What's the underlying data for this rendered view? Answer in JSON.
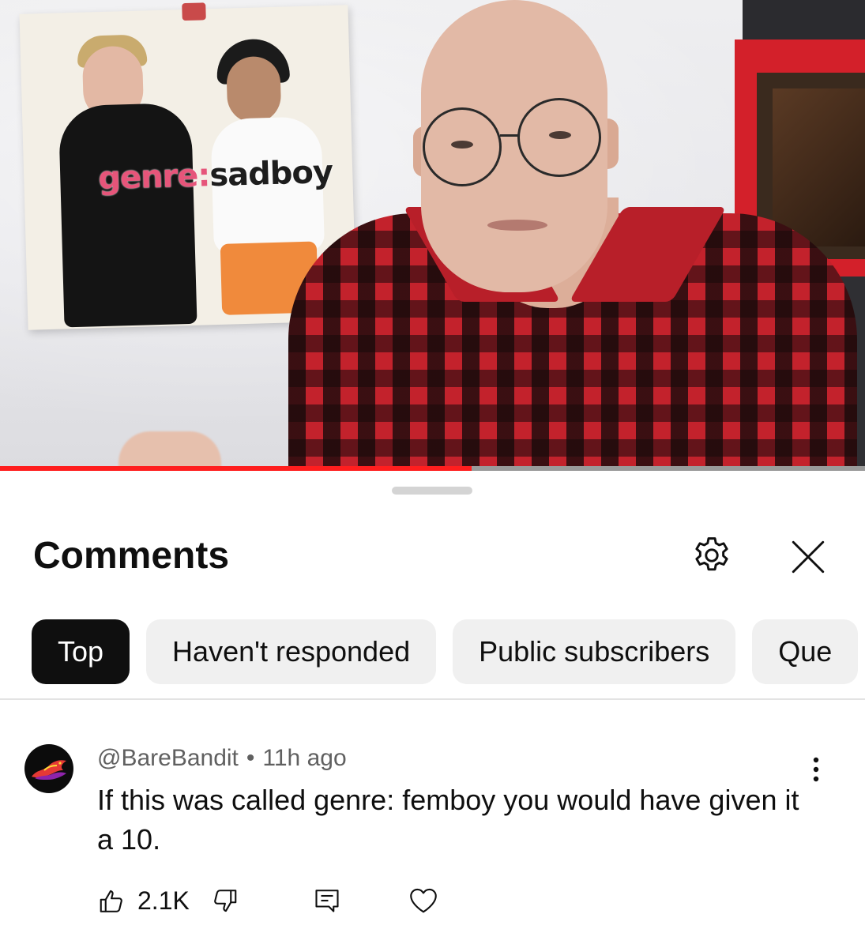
{
  "video": {
    "poster_text_genre": "genre",
    "poster_text_colon": ":",
    "poster_text_sadboy": "sadboy",
    "progress_fraction": 0.545,
    "colors": {
      "progress": "#ff1e1e",
      "shirt_red": "#c3222c",
      "shelf_red": "#d3202a"
    }
  },
  "comments_panel": {
    "title": "Comments",
    "settings_icon": "gear-icon",
    "close_icon": "close-icon",
    "filters": [
      {
        "label": "Top",
        "selected": true
      },
      {
        "label": "Haven't responded",
        "selected": false
      },
      {
        "label": "Public subscribers",
        "selected": false
      },
      {
        "label": "Que",
        "selected": false
      }
    ],
    "comment": {
      "author": "@BareBandit",
      "separator": "•",
      "time": "11h ago",
      "text": "If this was called genre: femboy you would have given it a 10.",
      "likes": "2.1K",
      "icons": [
        "thumbs-up-icon",
        "thumbs-down-icon",
        "reply-icon",
        "heart-icon",
        "more-vertical-icon"
      ]
    }
  }
}
